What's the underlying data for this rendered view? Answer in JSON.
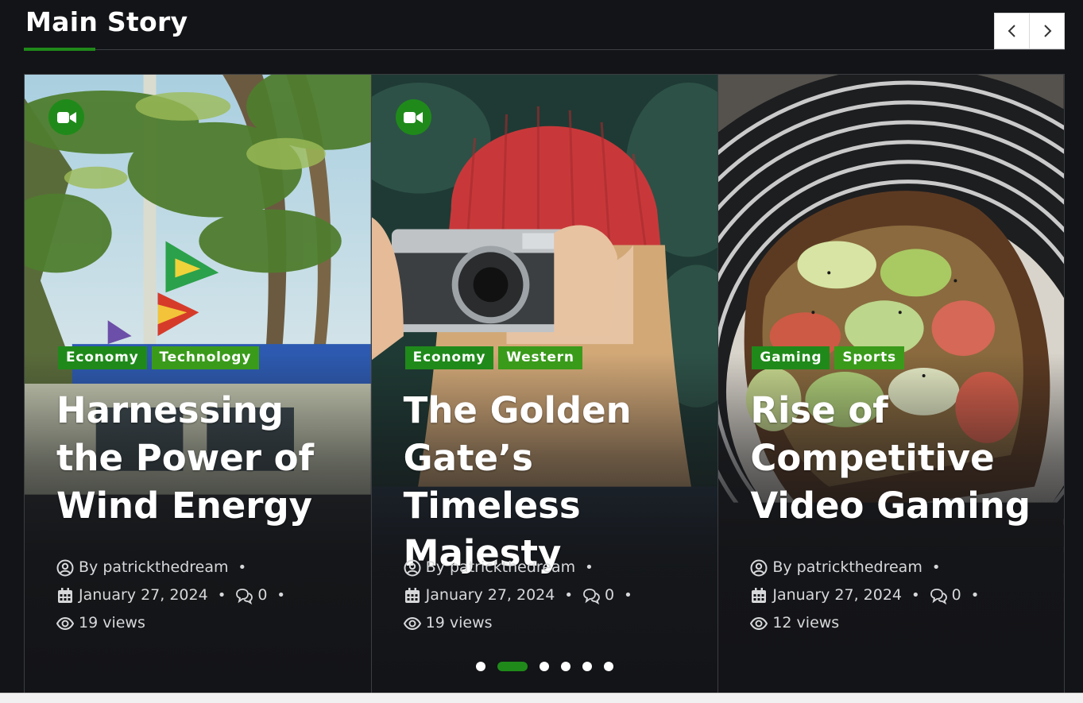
{
  "section": {
    "title": "Main Story"
  },
  "nav": {
    "prev_icon": "chevron-left-icon",
    "next_icon": "chevron-right-icon"
  },
  "colors": {
    "accent": "#1f8a1a",
    "background": "#131417"
  },
  "cards": [
    {
      "has_video": true,
      "categories": [
        "Economy",
        "Technology"
      ],
      "title": "Harnessing the Power of Wind Energy",
      "author": "By patrickthedream",
      "date": "January 27, 2024",
      "comments": "0",
      "views": "19 views",
      "image": "palm-trees-flags-van"
    },
    {
      "has_video": true,
      "categories": [
        "Economy",
        "Western"
      ],
      "title": "The Golden Gate’s Timeless Majesty",
      "author": "By patrickthedream",
      "date": "January 27, 2024",
      "comments": "0",
      "views": "19 views",
      "image": "woman-red-beanie-camera"
    },
    {
      "has_video": false,
      "categories": [
        "Gaming",
        "Sports"
      ],
      "title": "Rise of Competitive Video Gaming",
      "author": "By patrickthedream",
      "date": "January 27, 2024",
      "comments": "0",
      "views": "12 views",
      "image": "avocado-toast-plate"
    }
  ],
  "pager": {
    "count": 6,
    "active_index": 1
  }
}
